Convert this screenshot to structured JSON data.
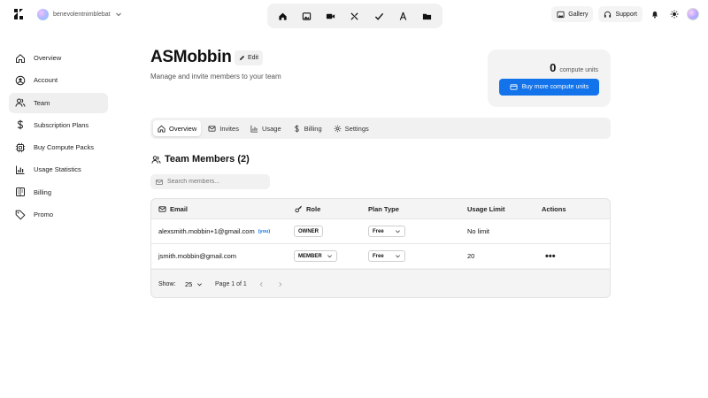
{
  "topbar": {
    "workspace": "benevolentnimblebat",
    "gallery_label": "Gallery",
    "support_label": "Support",
    "tools": [
      "home-icon",
      "image-icon",
      "video-icon",
      "magic-tools-icon",
      "check-icon",
      "compass-icon",
      "folder-icon"
    ]
  },
  "sidebar": {
    "items": [
      {
        "label": "Overview",
        "icon": "home-icon"
      },
      {
        "label": "Account",
        "icon": "user-circle-icon"
      },
      {
        "label": "Team",
        "icon": "team-icon"
      },
      {
        "label": "Subscription Plans",
        "icon": "dollar-icon"
      },
      {
        "label": "Buy Compute Packs",
        "icon": "chip-icon"
      },
      {
        "label": "Usage Statistics",
        "icon": "bar-chart-icon"
      },
      {
        "label": "Billing",
        "icon": "billing-icon"
      },
      {
        "label": "Promo",
        "icon": "tag-icon"
      }
    ],
    "active_index": 2
  },
  "header": {
    "title": "ASMobbin",
    "edit_label": "Edit",
    "subtitle": "Manage and invite members to your team"
  },
  "compute": {
    "units": "0",
    "units_label": "compute units",
    "buy_label": "Buy more compute units",
    "accent": "#1273eb"
  },
  "tabs": [
    {
      "label": "Overview",
      "icon": "home-icon"
    },
    {
      "label": "Invites",
      "icon": "mail-icon"
    },
    {
      "label": "Usage",
      "icon": "bar-chart-icon"
    },
    {
      "label": "Billing",
      "icon": "dollar-icon"
    },
    {
      "label": "Settings",
      "icon": "gear-icon"
    }
  ],
  "members": {
    "title": "Team Members (2)",
    "search_placeholder": "Search members...",
    "columns": [
      "Email",
      "Role",
      "Plan Type",
      "Usage Limit",
      "Actions"
    ],
    "rows": [
      {
        "email": "alexsmith.mobbin+1@gmail.com",
        "you_tag": "(you)",
        "role": "OWNER",
        "plan": "Free",
        "limit": "No limit",
        "actions": ""
      },
      {
        "email": "jsmith.mobbin@gmail.com",
        "you_tag": "",
        "role": "MEMBER",
        "plan": "Free",
        "limit": "20",
        "actions": "•••"
      }
    ],
    "footer": {
      "show_label": "Show:",
      "page_size": "25",
      "page_label": "Page 1 of 1"
    }
  }
}
